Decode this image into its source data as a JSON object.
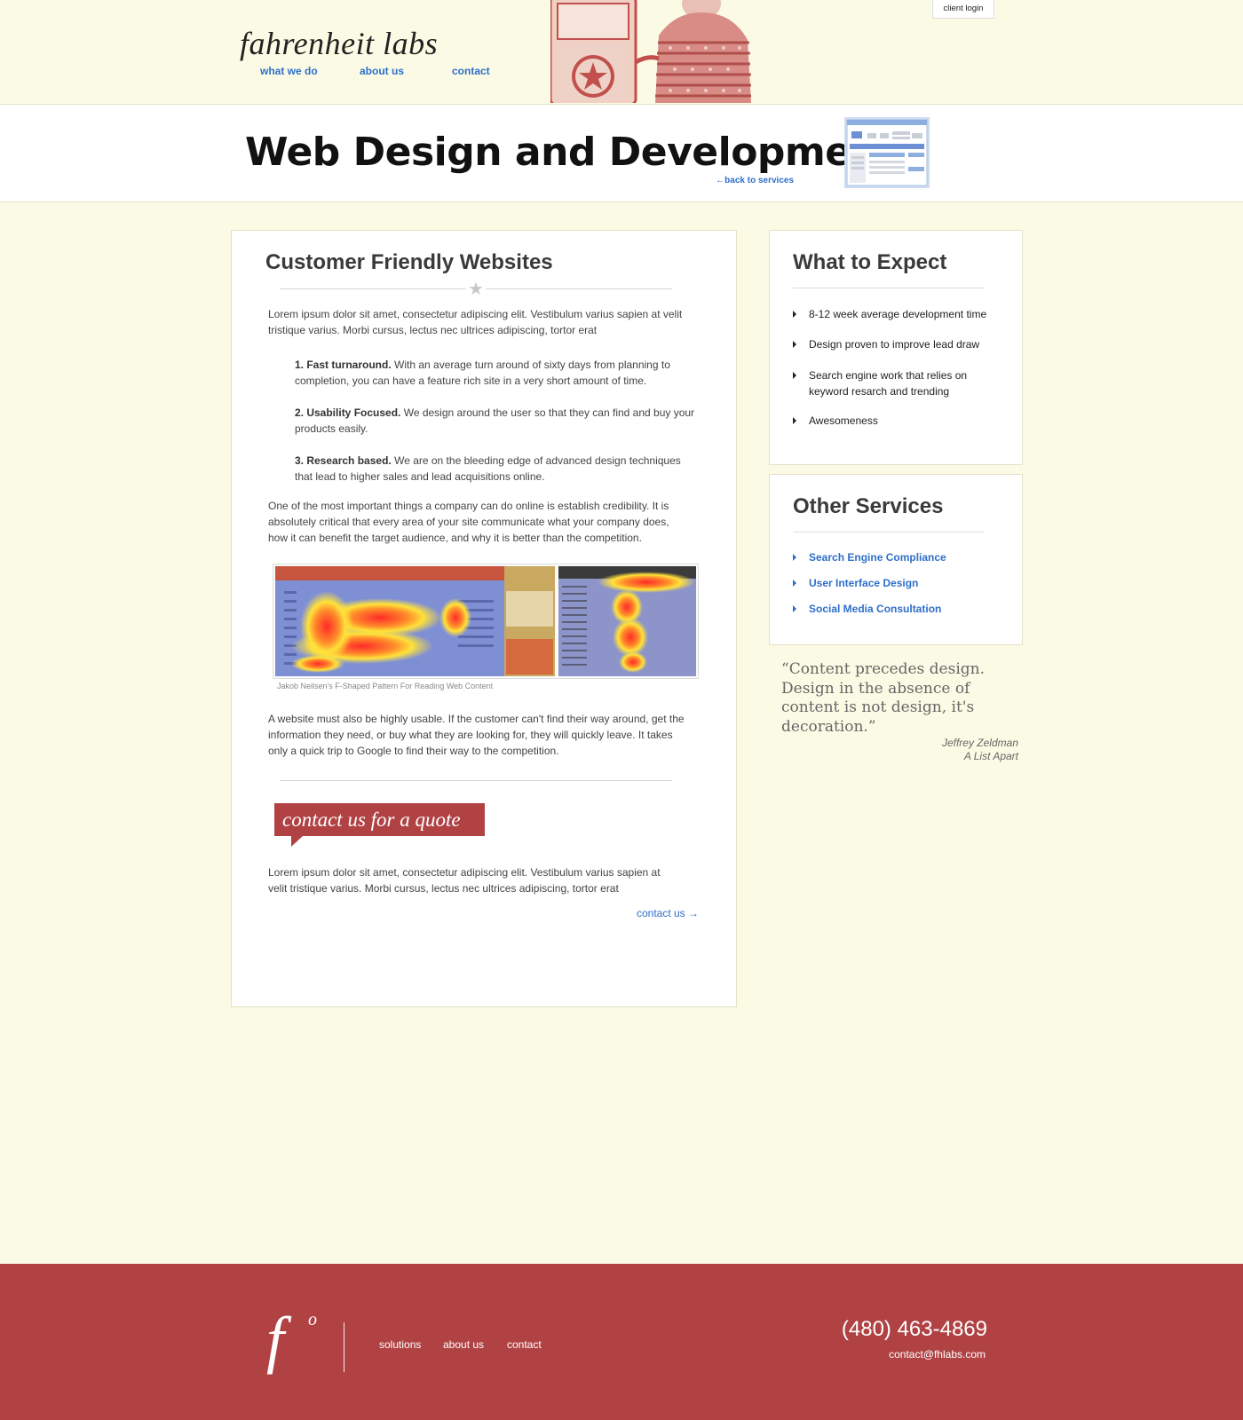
{
  "header": {
    "logo": "fahrenheit labs",
    "nav": [
      "what we do",
      "about us",
      "contact"
    ],
    "client_login": "client login"
  },
  "title_band": {
    "title": "Web Design and Development",
    "back_link": "←back to services"
  },
  "main": {
    "heading": "Customer Friendly Websites",
    "intro": "Lorem ipsum dolor sit amet, consectetur adipiscing elit. Vestibulum varius sapien at velit tristique varius. Morbi cursus, lectus nec ultrices adipiscing, tortor erat",
    "list": [
      {
        "title": "1. Fast turnaround.",
        "text": "With an average turn around of sixty days from planning to completion, you can have a feature rich site in a very short amount of time."
      },
      {
        "title": "2. Usability Focused.",
        "text": "We design around the user so that they can find and buy your products easily."
      },
      {
        "title": "3. Research based.",
        "text": "We are on the bleeding edge of advanced design techniques that lead to higher sales and lead acquisitions online."
      }
    ],
    "credibility": "One of the most important things a company can do online is establish credibility. It is absolutely critical that every area of your site communicate what your company does, how it can benefit the target audience, and why it is better than the competition.",
    "image_caption": "Jakob Neilsen's F-Shaped Pattern For Reading Web Content",
    "usability": "A website must also be highly usable. If the customer can't find their way around, get the information they need, or buy what they are looking for, they will quickly leave. It takes only a quick trip to Google to find their way to the competition.",
    "quote_tab": "contact us for a quote",
    "outro": "Lorem ipsum dolor sit amet, consectetur adipiscing elit. Vestibulum varius sapien at velit tristique varius. Morbi cursus, lectus nec ultrices adipiscing, tortor erat",
    "contact_link": "contact us →"
  },
  "sidebar": {
    "expect": {
      "heading": "What to Expect",
      "items": [
        "8-12 week average development time",
        "Design proven to improve lead draw",
        "Search engine work that relies on keyword resarch and trending",
        "Awesomeness"
      ]
    },
    "other": {
      "heading": "Other Services",
      "items": [
        "Search Engine Compliance",
        "User Interface Design",
        "Social Media Consultation"
      ]
    },
    "quote": {
      "text": "“Content precedes design. Design in the absence of content is not design, it's decoration.”",
      "author": "Jeffrey Zeldman",
      "source": "A List Apart"
    }
  },
  "footer": {
    "logo_letter": "f",
    "logo_degree": "o",
    "nav": [
      "solutions",
      "about us",
      "contact"
    ],
    "phone": "(480) 463-4869",
    "email": "contact@fhlabs.com"
  },
  "colors": {
    "background": "#fbfbe5",
    "accent_red": "#b14244",
    "link_blue": "#2f6fc9"
  },
  "icons": [
    "star-divider-icon",
    "bullet-arrow-icon",
    "website-thumbnail-icon"
  ]
}
